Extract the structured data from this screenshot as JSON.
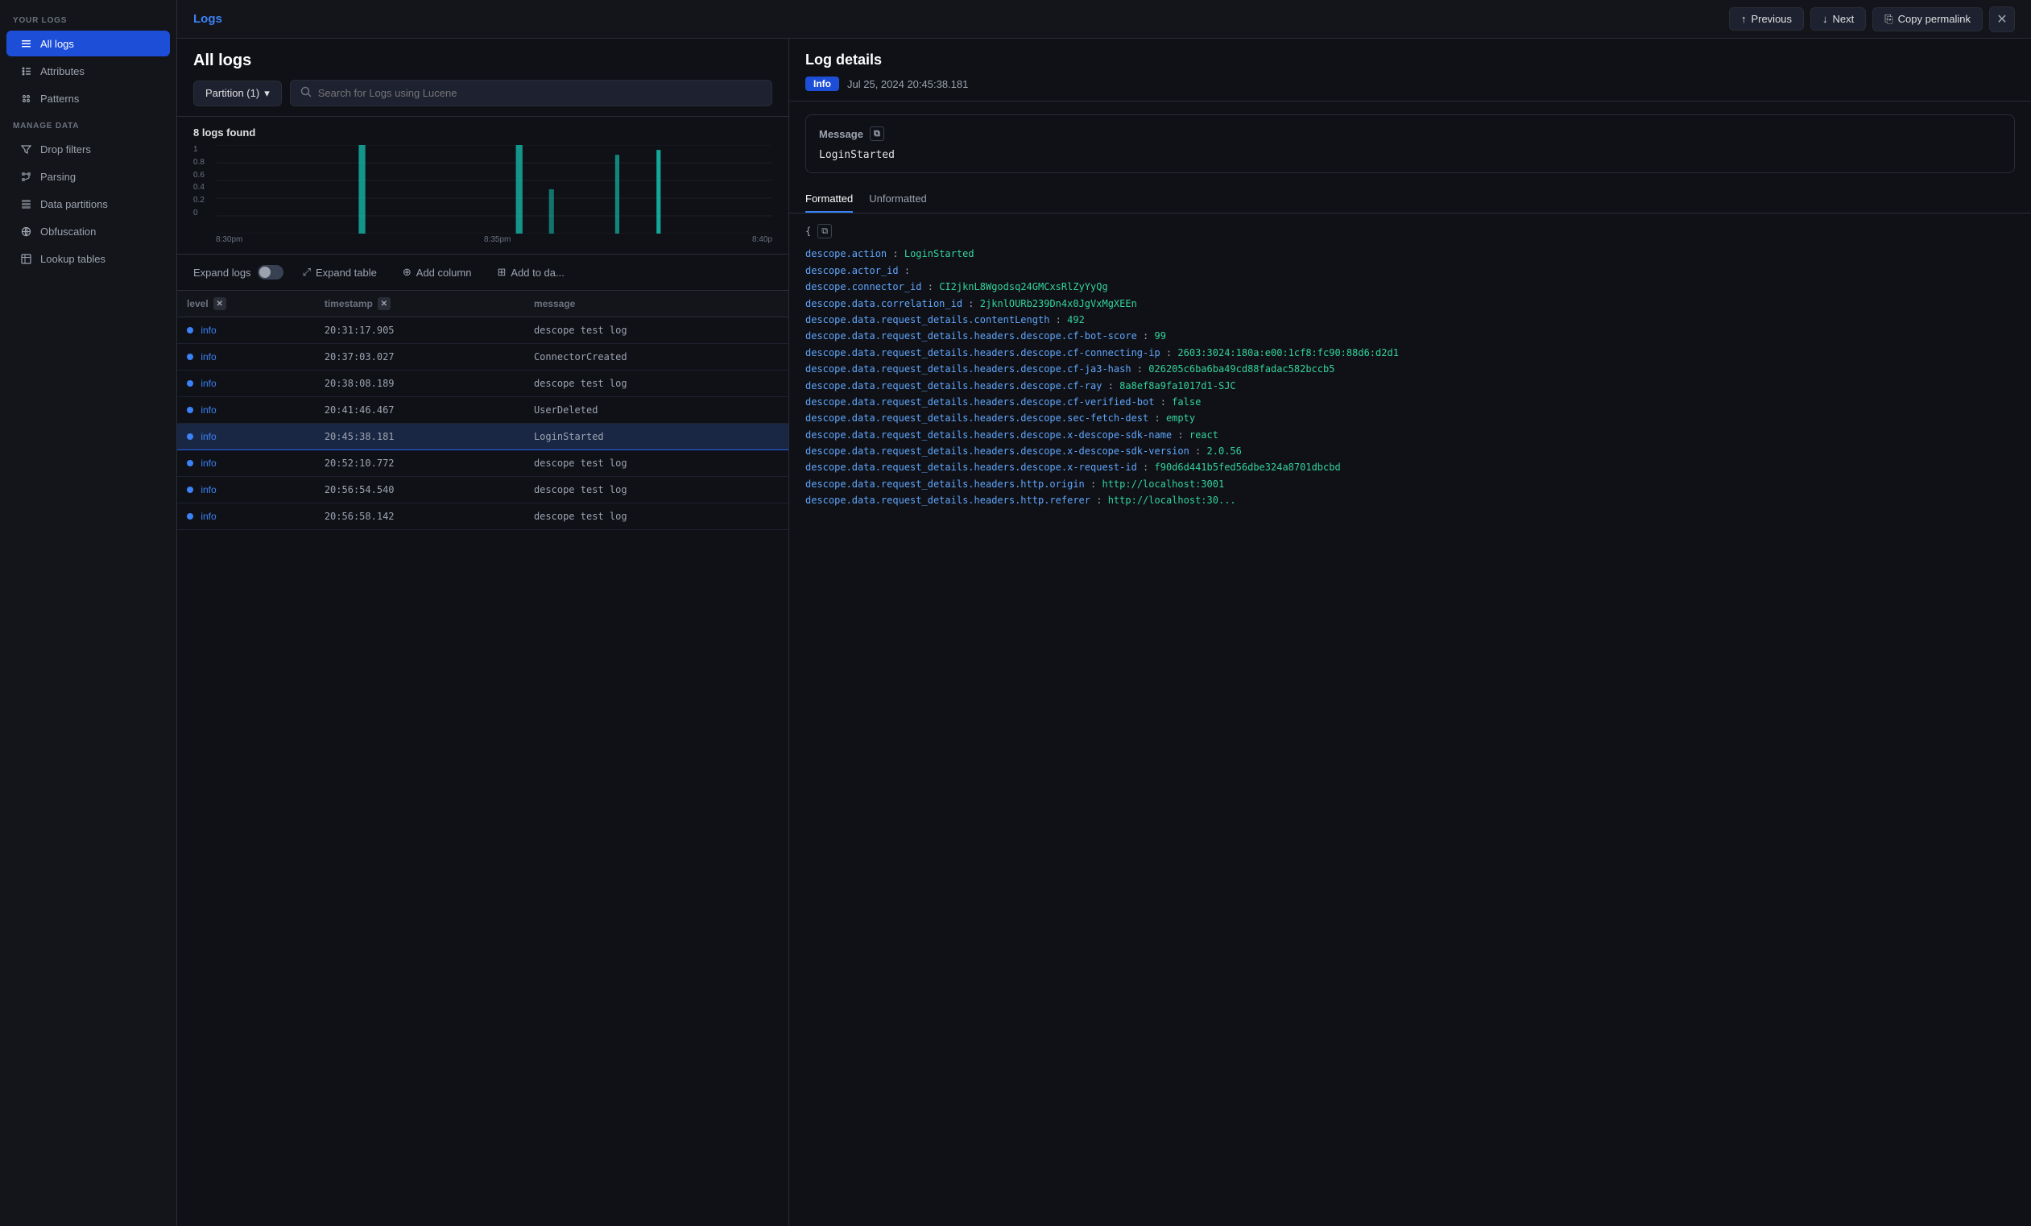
{
  "sidebar": {
    "your_logs_label": "YOUR LOGS",
    "manage_data_label": "MANAGE DATA",
    "items": [
      {
        "id": "all-logs",
        "label": "All logs",
        "active": true
      },
      {
        "id": "attributes",
        "label": "Attributes",
        "active": false
      },
      {
        "id": "patterns",
        "label": "Patterns",
        "active": false
      },
      {
        "id": "drop-filters",
        "label": "Drop filters",
        "active": false
      },
      {
        "id": "parsing",
        "label": "Parsing",
        "active": false
      },
      {
        "id": "data-partitions",
        "label": "Data partitions",
        "active": false
      },
      {
        "id": "obfuscation",
        "label": "Obfuscation",
        "active": false
      },
      {
        "id": "lookup-tables",
        "label": "Lookup tables",
        "active": false
      }
    ]
  },
  "topbar": {
    "title": "Logs",
    "prev_label": "Previous",
    "next_label": "Next",
    "copy_label": "Copy permalink"
  },
  "logs_panel": {
    "title": "All logs",
    "partition_label": "Partition (1)",
    "search_placeholder": "Search for Logs using Lucene",
    "logs_found": "8 logs found",
    "chart": {
      "y_labels": [
        "1",
        "0.8",
        "0.6",
        "0.4",
        "0.2",
        "0"
      ],
      "x_labels": [
        "8:30pm",
        "8:35pm",
        "8:40p"
      ]
    },
    "table_controls": {
      "expand_logs": "Expand logs",
      "expand_table": "Expand table",
      "add_column": "Add column",
      "add_to_da": "Add to da..."
    },
    "columns": [
      "level",
      "timestamp",
      "message"
    ],
    "rows": [
      {
        "level": "info",
        "timestamp": "20:31:17.905",
        "message": "descope test log",
        "selected": false
      },
      {
        "level": "info",
        "timestamp": "20:37:03.027",
        "message": "ConnectorCreated",
        "selected": false
      },
      {
        "level": "info",
        "timestamp": "20:38:08.189",
        "message": "descope test log",
        "selected": false
      },
      {
        "level": "info",
        "timestamp": "20:41:46.467",
        "message": "UserDeleted",
        "selected": false
      },
      {
        "level": "info",
        "timestamp": "20:45:38.181",
        "message": "LoginStarted",
        "selected": true
      },
      {
        "level": "info",
        "timestamp": "20:52:10.772",
        "message": "descope test log",
        "selected": false
      },
      {
        "level": "info",
        "timestamp": "20:56:54.540",
        "message": "descope test log",
        "selected": false
      },
      {
        "level": "info",
        "timestamp": "20:56:58.142",
        "message": "descope test log",
        "selected": false
      }
    ]
  },
  "details_panel": {
    "title": "Log details",
    "badge": "Info",
    "timestamp": "Jul 25, 2024 20:45:38.181",
    "message_label": "Message",
    "message_value": "LoginStarted",
    "tabs": [
      "Formatted",
      "Unformatted"
    ],
    "active_tab": "Formatted",
    "json_fields": [
      {
        "key": "descope.action",
        "value": "LoginStarted",
        "type": "string"
      },
      {
        "key": "descope.actor_id",
        "value": "",
        "type": "empty"
      },
      {
        "key": "descope.connector_id",
        "value": "CI2jknL8Wgodsq24GMCxsRlZyYyQg",
        "type": "string"
      },
      {
        "key": "descope.data.correlation_id",
        "value": "2jknlOURb239Dn4x0JgVxMgXEEn",
        "type": "string"
      },
      {
        "key": "descope.data.request_details.contentLength",
        "value": "492",
        "type": "number"
      },
      {
        "key": "descope.data.request_details.headers.descope.cf-bot-score",
        "value": "99",
        "type": "number"
      },
      {
        "key": "descope.data.request_details.headers.descope.cf-connecting-ip",
        "value": "2603:3024:180a:e00:1cf8:fc90:88d6:d2d1",
        "type": "string"
      },
      {
        "key": "descope.data.request_details.headers.descope.cf-ja3-hash",
        "value": "026205c6ba6ba49cd88fadac582bccb5",
        "type": "string"
      },
      {
        "key": "descope.data.request_details.headers.descope.cf-ray",
        "value": "8a8ef8a9fa1017d1-SJC",
        "type": "string"
      },
      {
        "key": "descope.data.request_details.headers.descope.cf-verified-bot",
        "value": "false",
        "type": "bool"
      },
      {
        "key": "descope.data.request_details.headers.descope.sec-fetch-dest",
        "value": "empty",
        "type": "string"
      },
      {
        "key": "descope.data.request_details.headers.descope.x-descope-sdk-name",
        "value": "react",
        "type": "string"
      },
      {
        "key": "descope.data.request_details.headers.descope.x-descope-sdk-version",
        "value": "2.0.56",
        "type": "string"
      },
      {
        "key": "descope.data.request_details.headers.descope.x-request-id",
        "value": "f90d6d441b5fed56dbe324a8701dbcbd",
        "type": "string"
      },
      {
        "key": "descope.data.request_details.headers.http.origin",
        "value": "http://localhost:3001",
        "type": "string"
      },
      {
        "key": "descope.data.request_details.headers.http.referer",
        "value": "http://localhost:30...",
        "type": "string"
      }
    ]
  }
}
